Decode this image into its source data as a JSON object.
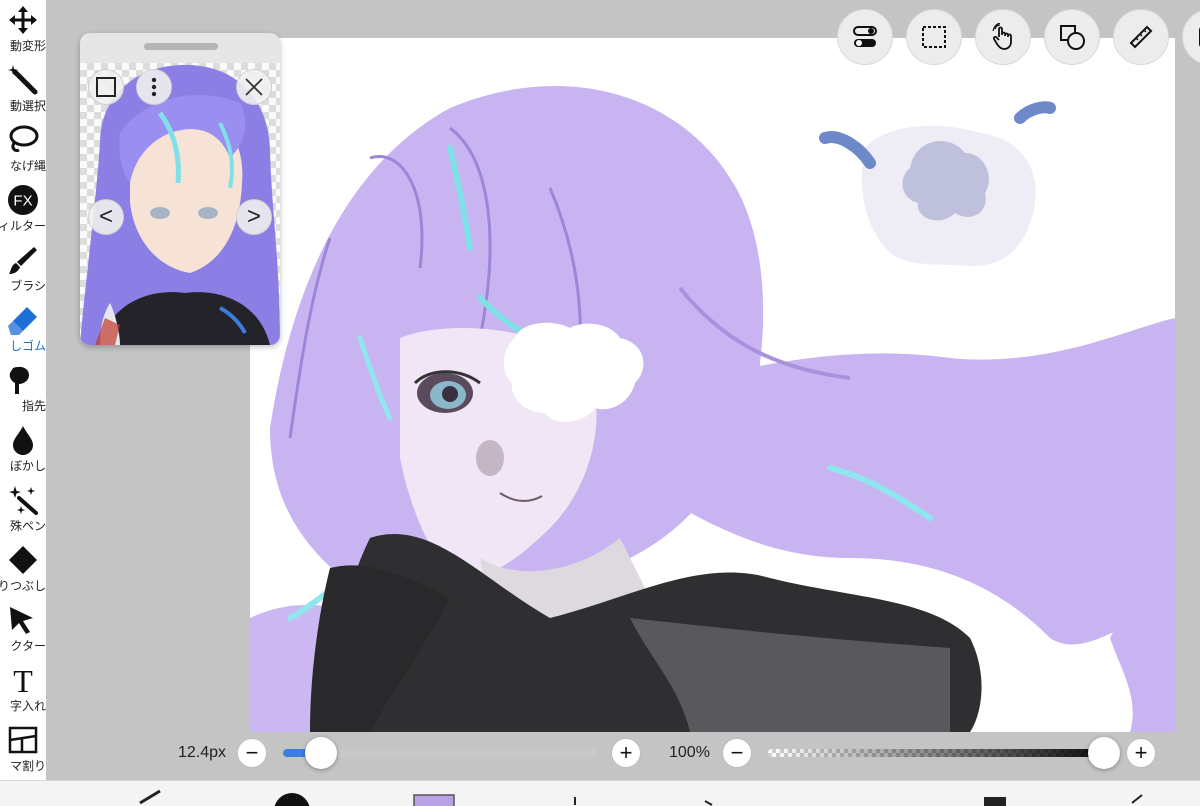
{
  "toolbar": {
    "tools": [
      {
        "id": "move",
        "label": "動変形",
        "icon": "move-arrows-icon"
      },
      {
        "id": "magic",
        "label": "動選択",
        "icon": "magic-wand-icon"
      },
      {
        "id": "lasso",
        "label": "なげ縄",
        "icon": "lasso-icon"
      },
      {
        "id": "filter",
        "label": "ィルター",
        "icon": "fx-icon",
        "icon_text": "FX"
      },
      {
        "id": "brush",
        "label": "ブラシ",
        "icon": "brush-icon"
      },
      {
        "id": "eraser",
        "label": "しゴム",
        "icon": "eraser-icon",
        "active": true
      },
      {
        "id": "smudge",
        "label": "指先",
        "icon": "smudge-finger-icon"
      },
      {
        "id": "blur",
        "label": "ぼかし",
        "icon": "drop-icon"
      },
      {
        "id": "special",
        "label": "殊ペン",
        "icon": "sparkle-pen-icon"
      },
      {
        "id": "fill",
        "label": "りつぶし",
        "icon": "fill-diamond-icon"
      },
      {
        "id": "select",
        "label": "クター",
        "icon": "pointer-arrow-icon"
      },
      {
        "id": "text",
        "label": "字入れ",
        "icon": "text-icon",
        "icon_text": "T"
      },
      {
        "id": "frame",
        "label": "マ割り",
        "icon": "frame-divider-icon"
      }
    ],
    "active_color": "#1c6fd6"
  },
  "top_buttons": [
    {
      "id": "toggle",
      "icon": "toggle-switches-icon"
    },
    {
      "id": "selection",
      "icon": "dashed-selection-icon"
    },
    {
      "id": "gesture",
      "icon": "hand-touch-icon"
    },
    {
      "id": "shape",
      "icon": "shape-square-circle-icon"
    },
    {
      "id": "ruler",
      "icon": "ruler-icon"
    },
    {
      "id": "layers",
      "icon": "layer-panel-icon"
    }
  ],
  "reference_window": {
    "icons": [
      "square-icon",
      "more-vertical-icon",
      "close-icon",
      "chevron-left-icon",
      "chevron-right-icon"
    ],
    "prev_glyph": "<",
    "next_glyph": ">"
  },
  "brush_size": {
    "label": "12.4px",
    "level": 0.12,
    "minus": "−",
    "plus": "+"
  },
  "opacity": {
    "label": "100%",
    "level": 1.0,
    "minus": "−",
    "plus": "+"
  },
  "colors": {
    "accent": "#3b7ee0",
    "hair": "#c9b4f2",
    "dark": "#2f2f31",
    "canvas": "#ffffff"
  }
}
